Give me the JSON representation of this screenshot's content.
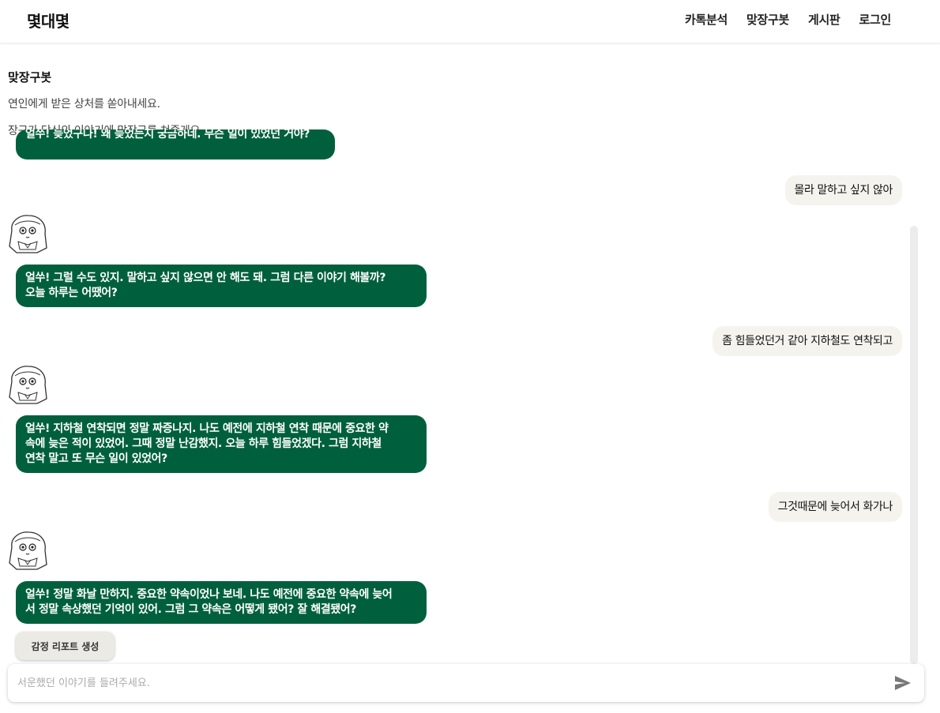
{
  "header": {
    "brand": "몇대몇",
    "nav": [
      "카톡분석",
      "맞장구봇",
      "게시판",
      "로그인"
    ]
  },
  "page": {
    "title": "맞장구봇",
    "description_lines": [
      "연인에게 받은 상처를 쏟아내세요.",
      "장구가 당신의 이야기에 맞장구를 쳐줄게요."
    ]
  },
  "messages": [
    {
      "role": "bot",
      "lines": [
        "얼쑤! 늦었구나! 왜 늦었는지 궁금하네. 무슨 일이 있었던 거야?"
      ]
    },
    {
      "role": "user",
      "text": "몰라 말하고 싶지 않아"
    },
    {
      "role": "bot",
      "lines": [
        "얼쑤! 그럴 수도 있지. 말하고 싶지 않으면 안 해도 돼. 그럼 다른 이야기 해볼까?",
        "오늘 하루는 어땠어?"
      ]
    },
    {
      "role": "user",
      "text": "좀 힘들었던거 같아 지하철도 연착되고"
    },
    {
      "role": "bot",
      "lines": [
        "얼쑤! 지하철 연착되면 정말 짜증나지. 나도 예전에 지하철 연착 때문에 중요한 약",
        "속에 늦은 적이 있었어. 그때 정말 난감했지. 오늘 하루 힘들었겠다. 그럼 지하철",
        "연착 말고 또 무슨 일이 있었어?"
      ]
    },
    {
      "role": "user",
      "text": "그것때문에 늦어서 화가나"
    },
    {
      "role": "bot",
      "lines": [
        "얼쑤! 정말 화날 만하지. 중요한 약속이었나 보네. 나도 예전에 중요한 약속에 늦어",
        "서 정말 속상했던 기억이 있어. 그럼 그 약속은 어떻게 됐어? 잘 해결됐어?"
      ]
    }
  ],
  "report_button": "감정 리포트 생성",
  "input": {
    "placeholder": "서운했던 이야기를 들려주세요.",
    "value": ""
  },
  "colors": {
    "bot_bubble": "#00603d",
    "user_bubble": "#f5f3ee",
    "brand_text": "#111111"
  },
  "icons": {
    "avatar": "janggu-character-avatar",
    "send": "send-icon"
  }
}
